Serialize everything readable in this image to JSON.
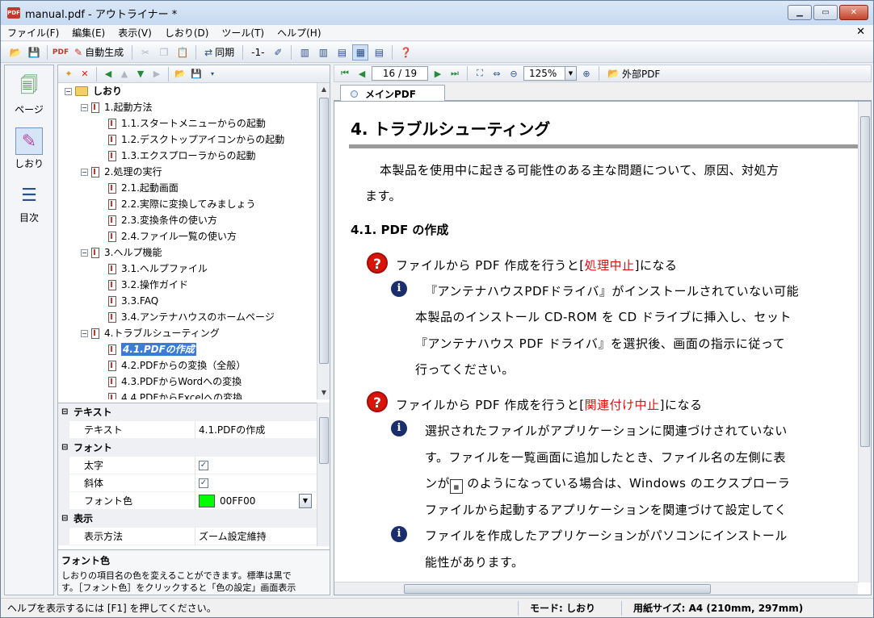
{
  "window": {
    "title": "manual.pdf - アウトライナー *",
    "app_icon": "PDF"
  },
  "menubar": {
    "items": [
      "ファイル(F)",
      "編集(E)",
      "表示(V)",
      "しおり(D)",
      "ツール(T)",
      "ヘルプ(H)"
    ]
  },
  "toolbar": {
    "auto_generate_label": "自動生成",
    "sync_label": "同期",
    "page_indicator": "-1-"
  },
  "sidebar": {
    "items": [
      {
        "label": "ページ",
        "icon": "page-icon"
      },
      {
        "label": "しおり",
        "icon": "bookmark-icon"
      },
      {
        "label": "目次",
        "icon": "toc-icon"
      }
    ]
  },
  "tree": {
    "root": "しおり",
    "nodes": [
      {
        "label": "1.起動方法",
        "level": 1,
        "expanded": true
      },
      {
        "label": "1.1.スタートメニューからの起動",
        "level": 2
      },
      {
        "label": "1.2.デスクトップアイコンからの起動",
        "level": 2
      },
      {
        "label": "1.3.エクスプローラからの起動",
        "level": 2
      },
      {
        "label": "2.処理の実行",
        "level": 1,
        "expanded": true
      },
      {
        "label": "2.1.起動画面",
        "level": 2
      },
      {
        "label": "2.2.実際に変換してみましょう",
        "level": 2
      },
      {
        "label": "2.3.変換条件の使い方",
        "level": 2
      },
      {
        "label": "2.4.ファイル一覧の使い方",
        "level": 2
      },
      {
        "label": "3.ヘルプ機能",
        "level": 1,
        "expanded": true
      },
      {
        "label": "3.1.ヘルプファイル",
        "level": 2
      },
      {
        "label": "3.2.操作ガイド",
        "level": 2
      },
      {
        "label": "3.3.FAQ",
        "level": 2
      },
      {
        "label": "3.4.アンテナハウスのホームページ",
        "level": 2
      },
      {
        "label": "4.トラブルシューティング",
        "level": 1,
        "expanded": true
      },
      {
        "label": "4.1.PDFの作成",
        "level": 2,
        "selected": true
      },
      {
        "label": "4.2.PDFからの変換（全般）",
        "level": 2
      },
      {
        "label": "4.3.PDFからWordへの変換",
        "level": 2
      },
      {
        "label": "4.4.PDFからExcelへの変換",
        "level": 2
      }
    ]
  },
  "properties": {
    "cat_text": "テキスト",
    "text_name": "テキスト",
    "text_value": "4.1.PDFの作成",
    "cat_font": "フォント",
    "bold_name": "太字",
    "bold_checked": "✓",
    "italic_name": "斜体",
    "italic_checked": "✓",
    "color_name": "フォント色",
    "color_value": "00FF00",
    "color_hex": "#00ff00",
    "cat_display": "表示",
    "display_name": "表示方法",
    "display_value": "ズーム設定維持"
  },
  "help": {
    "title": "フォント色",
    "text_line1": "しおりの項目名の色を変えることができます。標準は黒で",
    "text_line2": "す。［フォント色］をクリックすると「色の設定」画面表示"
  },
  "pdf_toolbar": {
    "page": "16 / 19",
    "zoom": "125%",
    "external_pdf_label": "外部PDF"
  },
  "tab": {
    "label": "メインPDF"
  },
  "pdf": {
    "heading": "4.  トラブルシューティング",
    "intro_line1": "本製品を使用中に起きる可能性のある主な問題について、原因、対処方",
    "intro_line2": "ます。",
    "section": "4.1.  PDF の作成",
    "q1_prefix": "ファイルから PDF 作成を行うと[",
    "q1_red": "処理中止",
    "q1_suffix": "]になる",
    "a1_line1": "『アンテナハウスPDFドライバ』がインストールされていない可能",
    "a1_line2": "本製品のインストール CD-ROM を CD ドライブに挿入し、セット",
    "a1_line3": "『アンテナハウス PDF ドライバ』を選択後、画面の指示に従って",
    "a1_line4": "行ってください。",
    "q2_prefix": "ファイルから PDF 作成を行うと[",
    "q2_red": "関連付け中止",
    "q2_suffix": "]になる",
    "a2_line1": "選択されたファイルがアプリケーションに関連づけされていない",
    "a2_line2": "す。ファイルを一覧画面に追加したとき、ファイル名の左側に表",
    "a2_line3_a": "ンが",
    "a2_line3_b": " のようになっている場合は、Windows のエクスプローラ",
    "a2_line4": "ファイルから起動するアプリケーションを関連づけて設定してく",
    "a3_line1": "ファイルを作成したアプリケーションがパソコンにインストール",
    "a3_line2": "能性があります。",
    "q_icon": "?",
    "i_icon": "i"
  },
  "status": {
    "help_text": "ヘルプを表示するには [F1] を押してください。",
    "mode": "モード: しおり",
    "paper": "用紙サイズ: A4 (210mm, 297mm)"
  }
}
